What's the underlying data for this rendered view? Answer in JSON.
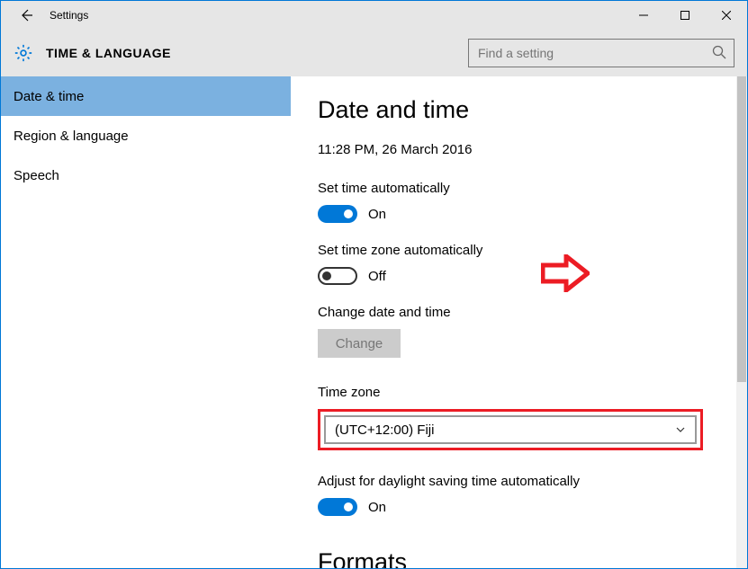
{
  "window": {
    "title": "Settings"
  },
  "header": {
    "title": "TIME & LANGUAGE"
  },
  "search": {
    "placeholder": "Find a setting"
  },
  "sidebar": {
    "items": [
      {
        "label": "Date & time",
        "selected": true
      },
      {
        "label": "Region & language",
        "selected": false
      },
      {
        "label": "Speech",
        "selected": false
      }
    ]
  },
  "content": {
    "page_title": "Date and time",
    "datetime": "11:28 PM, 26 March 2016",
    "set_time_auto": {
      "label": "Set time automatically",
      "state": "On",
      "on": true
    },
    "set_tz_auto": {
      "label": "Set time zone automatically",
      "state": "Off",
      "on": false
    },
    "change_dt": {
      "label": "Change date and time",
      "button": "Change"
    },
    "timezone": {
      "label": "Time zone",
      "value": "(UTC+12:00) Fiji"
    },
    "dst": {
      "label": "Adjust for daylight saving time automatically",
      "state": "On",
      "on": true
    },
    "formats_title": "Formats"
  }
}
